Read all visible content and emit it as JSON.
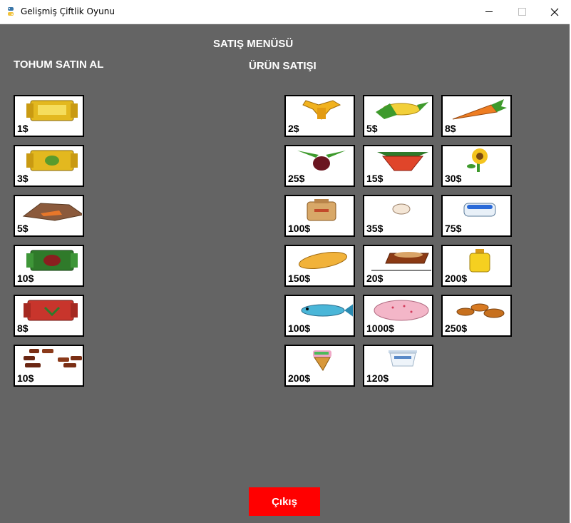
{
  "window": {
    "title": "Gelişmiş Çiftlik Oyunu"
  },
  "headings": {
    "menu": "SATIŞ MENÜSÜ",
    "seeds": "TOHUM SATIN AL",
    "products": "ÜRÜN SATIŞI"
  },
  "seeds": [
    {
      "icon": "yellow-seed-packet-icon",
      "price": "1$"
    },
    {
      "icon": "yellow-green-seed-packet-icon",
      "price": "3$"
    },
    {
      "icon": "carrot-seed-packet-icon",
      "price": "5$"
    },
    {
      "icon": "green-seed-packet-icon",
      "price": "10$"
    },
    {
      "icon": "red-seed-packet-icon",
      "price": "8$"
    },
    {
      "icon": "cocoa-seeds-icon",
      "price": "10$"
    }
  ],
  "products": [
    {
      "icon": "wheat-icon",
      "price": "2$"
    },
    {
      "icon": "corn-icon",
      "price": "5$"
    },
    {
      "icon": "carrot-icon",
      "price": "8$"
    },
    {
      "icon": "beet-icon",
      "price": "25$"
    },
    {
      "icon": "strawberry-icon",
      "price": "15$"
    },
    {
      "icon": "sunflower-icon",
      "price": "30$"
    },
    {
      "icon": "flour-sack-icon",
      "price": "100$"
    },
    {
      "icon": "egg-icon",
      "price": "35$"
    },
    {
      "icon": "milk-bowl-icon",
      "price": "75$"
    },
    {
      "icon": "bread-icon",
      "price": "150$"
    },
    {
      "icon": "chocolate-icon",
      "price": "20$"
    },
    {
      "icon": "oil-bottle-icon",
      "price": "200$"
    },
    {
      "icon": "fish-icon",
      "price": "100$"
    },
    {
      "icon": "cake-icon",
      "price": "1000$"
    },
    {
      "icon": "cookies-icon",
      "price": "250$"
    },
    {
      "icon": "ice-cream-icon",
      "price": "200$"
    },
    {
      "icon": "yogurt-icon",
      "price": "120$"
    }
  ],
  "exit_button": {
    "label": "Çıkış",
    "color": "#ff0000"
  },
  "colors": {
    "background": "#646464",
    "card": "#ffffff"
  }
}
